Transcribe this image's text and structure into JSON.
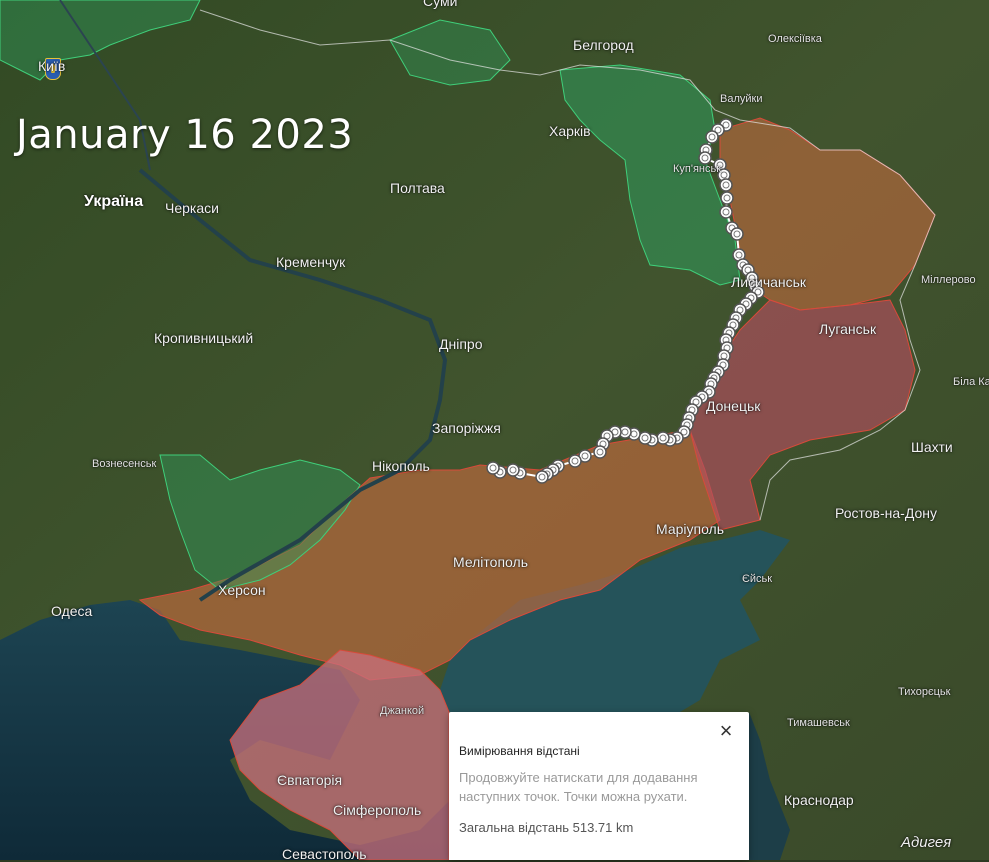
{
  "map": {
    "date_title": "January 16 2023",
    "cities": [
      {
        "name": "Суми",
        "cls": ""
      },
      {
        "name": "Київ",
        "cls": ""
      },
      {
        "name": "Белгород",
        "cls": ""
      },
      {
        "name": "Олексіївка",
        "cls": "small"
      },
      {
        "name": "Валуйки",
        "cls": "small"
      },
      {
        "name": "Харків",
        "cls": ""
      },
      {
        "name": "Куп'янськ",
        "cls": "small"
      },
      {
        "name": "Україна",
        "cls": "country"
      },
      {
        "name": "Черкаси",
        "cls": ""
      },
      {
        "name": "Полтава",
        "cls": ""
      },
      {
        "name": "Кременчук",
        "cls": ""
      },
      {
        "name": "Лисичанськ",
        "cls": ""
      },
      {
        "name": "Міллерово",
        "cls": "small"
      },
      {
        "name": "Луганськ",
        "cls": ""
      },
      {
        "name": "Кропивницький",
        "cls": ""
      },
      {
        "name": "Дніпро",
        "cls": ""
      },
      {
        "name": "Біла Ка",
        "cls": "small"
      },
      {
        "name": "Донецьк",
        "cls": ""
      },
      {
        "name": "Запоріжжя",
        "cls": ""
      },
      {
        "name": "Шахти",
        "cls": ""
      },
      {
        "name": "Вознесенськ",
        "cls": "small"
      },
      {
        "name": "Нікополь",
        "cls": ""
      },
      {
        "name": "Ростов-на-Дону",
        "cls": ""
      },
      {
        "name": "Маріуполь",
        "cls": ""
      },
      {
        "name": "Мелітополь",
        "cls": ""
      },
      {
        "name": "Єйськ",
        "cls": "small"
      },
      {
        "name": "Одеса",
        "cls": ""
      },
      {
        "name": "Херсон",
        "cls": ""
      },
      {
        "name": "Тихорєцьк",
        "cls": "small"
      },
      {
        "name": "Джанкой",
        "cls": "small"
      },
      {
        "name": "Тимашевськ",
        "cls": "small"
      },
      {
        "name": "Євпаторія",
        "cls": ""
      },
      {
        "name": "Сімферополь",
        "cls": ""
      },
      {
        "name": "Краснодар",
        "cls": ""
      },
      {
        "name": "Адигея",
        "cls": "italic"
      },
      {
        "name": "Севастополь",
        "cls": ""
      }
    ],
    "colors": {
      "land": "#3d4f2c",
      "sea": "#1f3f4f",
      "occupied": "#c26a3e",
      "occupied_pre2022": "#b24e60",
      "liberated": "#2f9a5c",
      "measure_point": "#ffffff"
    }
  },
  "measure_popup": {
    "title": "Вимірювання відстані",
    "hint": "Продовжуйте натискати для додавання наступних точок. Точки можна рухати.",
    "total": "Загальна відстань 513.71 km",
    "close_icon": "close-icon"
  }
}
